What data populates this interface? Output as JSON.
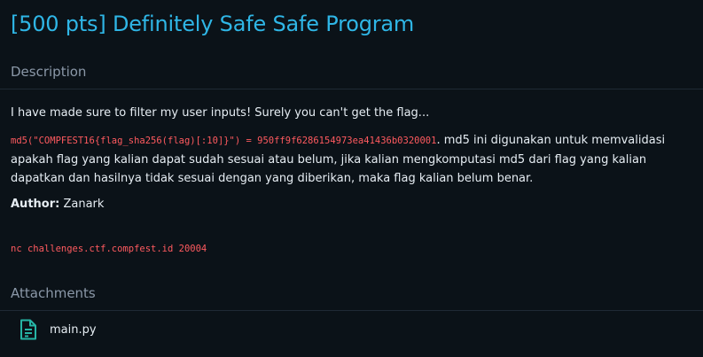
{
  "challenge": {
    "title": "[500 pts] Definitely Safe Safe Program"
  },
  "description": {
    "header": "Description",
    "intro": "I have made sure to filter my user inputs! Surely you can't get the flag...",
    "md5_code": "md5(\"COMPFEST16{flag_sha256(flag)[:10]}\") = 950ff9f6286154973ea41436b0320001",
    "md5_text": ". md5 ini digunakan untuk memvalidasi apakah flag yang kalian dapat sudah sesuai atau belum, jika kalian mengkomputasi md5 dari flag yang kalian dapatkan dan hasilnya tidak sesuai dengan yang diberikan, maka flag kalian belum benar.",
    "author_label": "Author:",
    "author_name": " Zanark",
    "connection": "nc challenges.ctf.compfest.id 20004"
  },
  "attachments": {
    "header": "Attachments",
    "files": [
      {
        "name": "main.py",
        "icon": "file-text-icon"
      }
    ]
  },
  "colors": {
    "background": "#0b1218",
    "title": "#2fb6e6",
    "code": "#ff5a5f",
    "muted": "#8b98a8",
    "icon": "#26b5a6"
  }
}
